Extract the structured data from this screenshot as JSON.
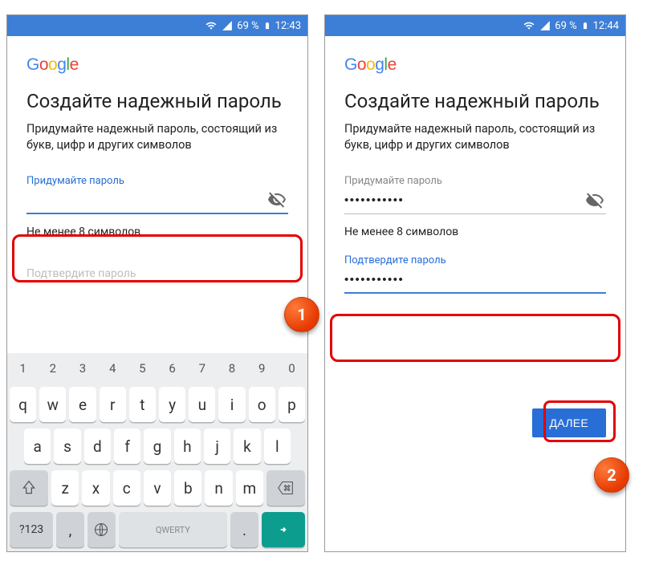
{
  "left": {
    "status": {
      "battery": "69 %",
      "time": "12:43"
    },
    "logo": "Google",
    "title": "Создайте надежный пароль",
    "subtitle": "Придумайте надежный пароль, состоящий из букв, цифр и других символов",
    "pw_label": "Придумайте пароль",
    "pw_value": "",
    "hint": "Не менее 8 символов",
    "confirm_partial": "Подтвердите пароль",
    "keyboard": {
      "nums": [
        "1",
        "2",
        "3",
        "4",
        "5",
        "6",
        "7",
        "8",
        "9",
        "0"
      ],
      "row1": [
        "q",
        "w",
        "e",
        "r",
        "t",
        "y",
        "u",
        "i",
        "o",
        "p"
      ],
      "row2": [
        "a",
        "s",
        "d",
        "f",
        "g",
        "h",
        "j",
        "k",
        "l"
      ],
      "row3": [
        "z",
        "x",
        "c",
        "v",
        "b",
        "n",
        "m"
      ],
      "sym": "?123",
      "space": "QWERTY",
      "comma": ",",
      "period": "."
    }
  },
  "right": {
    "status": {
      "battery": "69 %",
      "time": "12:44"
    },
    "logo": "Google",
    "title": "Создайте надежный пароль",
    "subtitle": "Придумайте надежный пароль, состоящий из букв, цифр и других символов",
    "pw_label": "Придумайте пароль",
    "pw_value": "•••••••••••",
    "hint": "Не менее 8 символов",
    "confirm_label": "Подтвердите пароль",
    "confirm_value": "•••••••••••",
    "next": "ДАЛЕЕ"
  },
  "markers": {
    "m1": "1",
    "m2": "2"
  }
}
